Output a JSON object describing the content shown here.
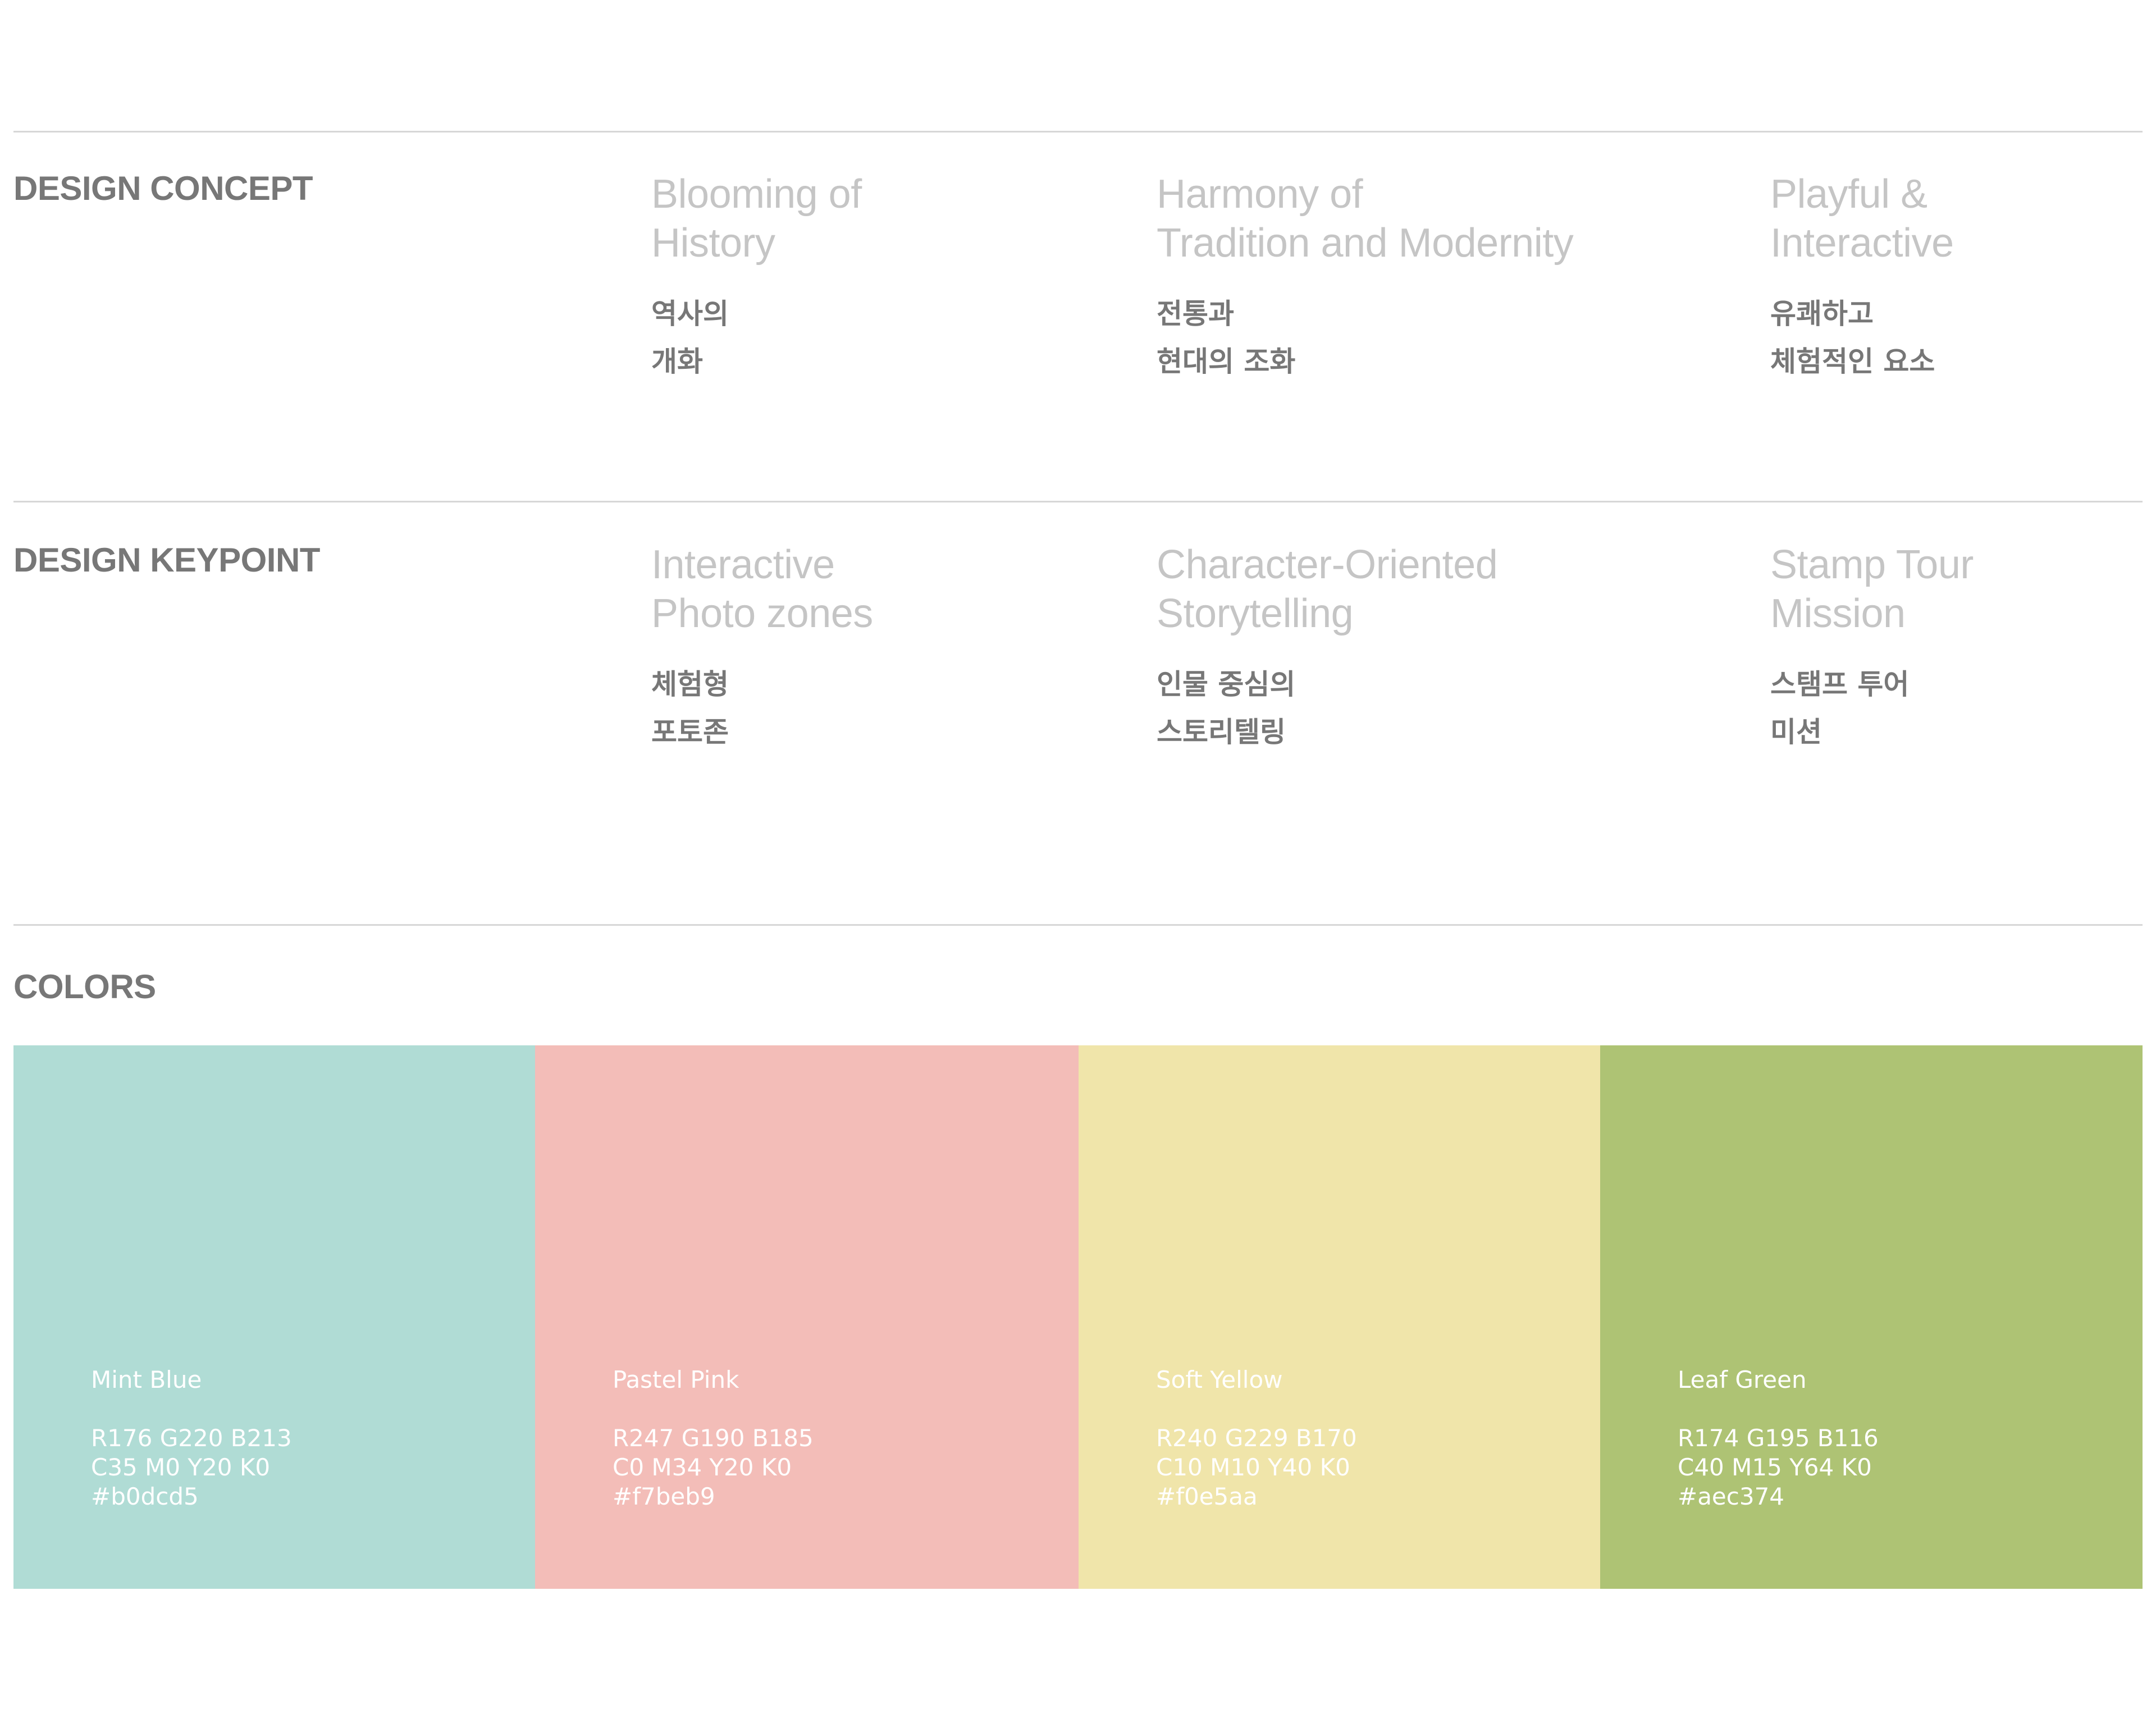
{
  "concept": {
    "title": "DESIGN CONCEPT",
    "items": [
      {
        "en": [
          "Blooming of",
          "History"
        ],
        "ko": [
          "역사의",
          "개화"
        ]
      },
      {
        "en": [
          "Harmony of",
          "Tradition and Modernity"
        ],
        "ko": [
          "전통과",
          "현대의 조화"
        ]
      },
      {
        "en": [
          "Playful &",
          "Interactive"
        ],
        "ko": [
          "유쾌하고",
          "체험적인 요소"
        ]
      }
    ]
  },
  "keypoint": {
    "title": "DESIGN KEYPOINT",
    "items": [
      {
        "en": [
          "Interactive",
          "Photo zones"
        ],
        "ko": [
          "체험형",
          "포토존"
        ]
      },
      {
        "en": [
          "Character-Oriented",
          "Storytelling"
        ],
        "ko": [
          "인물 중심의",
          "스토리텔링"
        ]
      },
      {
        "en": [
          "Stamp Tour",
          "Mission"
        ],
        "ko": [
          "스탬프 투어",
          "미션"
        ]
      }
    ]
  },
  "colors": {
    "title": "COLORS",
    "swatches": [
      {
        "name": "Mint Blue",
        "rgb": "R176 G220 B213",
        "cmyk": "C35 M0 Y20 K0",
        "hex": "#b0dcd5",
        "fill": "#b0dcd5"
      },
      {
        "name": "Pastel Pink",
        "rgb": "R247 G190 B185",
        "cmyk": "C0 M34 Y20 K0",
        "hex": "#f7beb9",
        "fill": "#f3bdb8"
      },
      {
        "name": "Soft Yellow",
        "rgb": "R240 G229 B170",
        "cmyk": "C10 M10 Y40 K0",
        "hex": "#f0e5aa",
        "fill": "#f0e5aa"
      },
      {
        "name": "Leaf Green",
        "rgb": "R174 G195 B116",
        "cmyk": "C40 M15 Y64 K0",
        "hex": "#aec374",
        "fill": "#aec374"
      }
    ]
  }
}
